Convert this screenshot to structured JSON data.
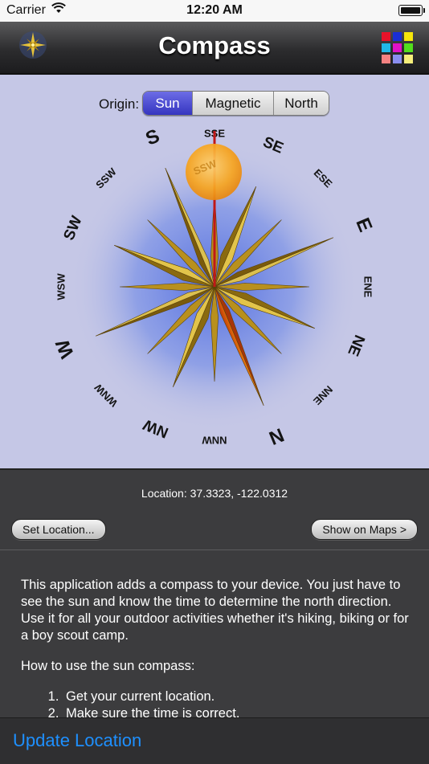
{
  "status_bar": {
    "carrier": "Carrier",
    "time": "12:20 AM"
  },
  "nav": {
    "title": "Compass",
    "grid_colors": [
      "#e8122a",
      "#1a2ed6",
      "#f5e60a",
      "#20b8e8",
      "#e011c8",
      "#52de1c",
      "#f58282",
      "#8a8ef0",
      "#f5ee7a"
    ]
  },
  "compass": {
    "origin_label": "Origin:",
    "segments": [
      {
        "label": "Sun",
        "selected": true
      },
      {
        "label": "Magnetic",
        "selected": false
      },
      {
        "label": "North",
        "selected": false
      }
    ],
    "direction_labels": [
      "N",
      "NNW",
      "NW",
      "WNW",
      "W",
      "WSW",
      "SW",
      "SSW",
      "S",
      "SSE",
      "SE",
      "ESE",
      "E",
      "ENE",
      "NE",
      "NNE"
    ],
    "rotation_deg": 157.5,
    "colors": {
      "sun": "#f7a520",
      "needle": "#d01818",
      "star": "#d6ae28",
      "north_point": "#e85a06",
      "glow": "#5a7be6",
      "background": "#c5c7e6"
    }
  },
  "info": {
    "location_label": "Location:",
    "location_value": "37.3323,  -122.0312",
    "set_location_button": "Set Location...",
    "show_maps_button": "Show on Maps >"
  },
  "description": {
    "paragraph": "This application adds a compass to your device. You just have to see the sun and know the time to determine the north direction. Use it for all your outdoor activities whether it's hiking, biking or for a boy scout camp.",
    "howto_title": "How to use the sun compass:",
    "steps": [
      "Get your current location.",
      "Make sure the time is correct."
    ]
  },
  "bottom_bar": {
    "update_location": "Update Location"
  }
}
